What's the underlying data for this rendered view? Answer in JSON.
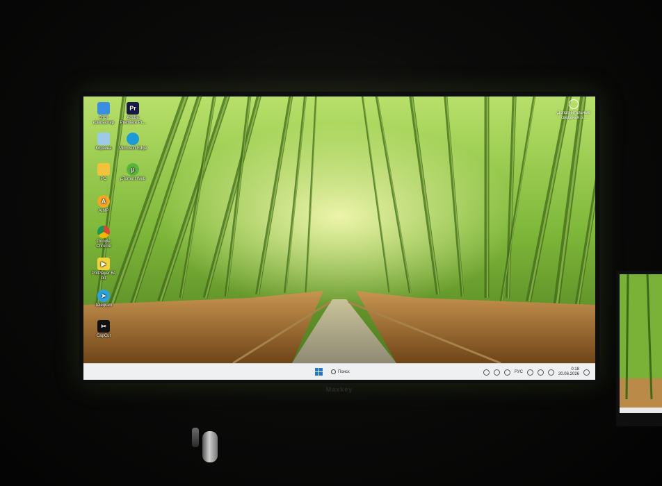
{
  "desktop": {
    "icons": [
      {
        "id": "this-pc",
        "label": "Этот компьютер",
        "color": "#3a8fe0",
        "glyph": ""
      },
      {
        "id": "premiere",
        "label": "Adobe Premiere Pr...",
        "color": "#1a1a4a",
        "glyph": "Pr"
      },
      {
        "id": "recycle-bin",
        "label": "Корзина",
        "color": "#9fc9e8",
        "glyph": ""
      },
      {
        "id": "edge",
        "label": "Microsoft Edge",
        "color": "#1a9ad6",
        "glyph": ""
      },
      {
        "id": "pc-folder",
        "label": "PC",
        "color": "#f3c13a",
        "glyph": ""
      },
      {
        "id": "utorrent",
        "label": "µTorrent Web",
        "color": "#59b43a",
        "glyph": "µ"
      },
      {
        "id": "aimp",
        "label": "AIMP",
        "color": "#f5a623",
        "glyph": "A"
      },
      {
        "id": "chrome",
        "label": "Google Chrome",
        "color": "#db4437",
        "glyph": ""
      },
      {
        "id": "potplayer",
        "label": "PotPlayer 64 bit",
        "color": "#f2d33c",
        "glyph": "▶"
      },
      {
        "id": "telegram",
        "label": "Telegram",
        "color": "#2aa3e0",
        "glyph": "➤"
      },
      {
        "id": "capcut",
        "label": "CapCut",
        "color": "#111111",
        "glyph": "✂"
      }
    ],
    "corner_widget": {
      "label": "Дополнительные сведения о..."
    }
  },
  "taskbar": {
    "search_placeholder": "Поиск",
    "language": "РУС",
    "time": "0:18",
    "date": "20.06.2026"
  },
  "monitor": {
    "brand": "Maxkey"
  },
  "colors": {
    "taskbar_bg": "#eef0f2",
    "start_blue": "#1c78d4",
    "bamboo_green": "#7fb83a",
    "grass_brown": "#b07a38"
  }
}
